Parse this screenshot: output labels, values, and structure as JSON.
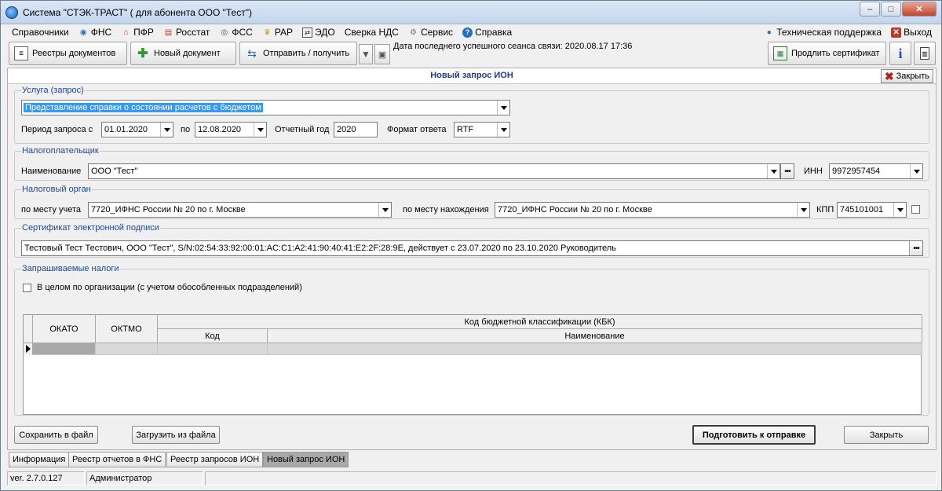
{
  "window": {
    "title": "Система \"СТЭК-ТРАСТ\" ( для абонента ООО \"Тест\")",
    "minimize": "‒",
    "maximize": "□",
    "close": "✕"
  },
  "menu": {
    "items": [
      {
        "label": "Справочники",
        "icon": ""
      },
      {
        "label": "ФНС",
        "icon": "fns-icon"
      },
      {
        "label": "ПФР",
        "icon": "pfr-icon"
      },
      {
        "label": "Росстат",
        "icon": "rosstat-icon"
      },
      {
        "label": "ФСС",
        "icon": "fss-icon"
      },
      {
        "label": "РАР",
        "icon": "rar-icon"
      },
      {
        "label": "ЭДО",
        "icon": "edo-icon"
      },
      {
        "label": "Сверка НДС",
        "icon": ""
      },
      {
        "label": "Сервис",
        "icon": "gear-icon"
      },
      {
        "label": "Справка",
        "icon": "help-icon"
      }
    ],
    "support": "Техническая поддержка",
    "exit": "Выход"
  },
  "toolbar": {
    "registries": "Реестры документов",
    "new_doc": "Новый документ",
    "send_receive": "Отправить / получить",
    "session_label": "Дата последнего успешного сеанса связи: 2020.08.17 17:36",
    "extend_cert": "Продлить сертификат"
  },
  "form": {
    "title": "Новый запрос ИОН",
    "close_top": "Закрыть",
    "service": {
      "legend": "Услуга (запрос)",
      "value": "Представление справки о состоянии расчетов с бюджетом",
      "period_label": "Период запроса  с",
      "date_from": "01.01.2020",
      "to_label": "по",
      "date_to": "12.08.2020",
      "year_label": "Отчетный год",
      "year": "2020",
      "format_label": "Формат ответа",
      "format": "RTF"
    },
    "taxpayer": {
      "legend": "Налогоплательщик",
      "name_label": "Наименование",
      "name": "ООО \"Тест\"",
      "inn_label": "ИНН",
      "inn": "9972957454"
    },
    "tax_authority": {
      "legend": "Налоговый орган",
      "reg_label": "по месту учета",
      "reg_value": "7720_ИФНС России № 20 по г. Москве",
      "loc_label": "по месту нахождения",
      "loc_value": "7720_ИФНС России № 20 по г. Москве",
      "kpp_label": "КПП",
      "kpp": "745101001"
    },
    "certificate": {
      "legend": "Сертификат электронной подписи",
      "value": "Тестовый Тест Тестович, ООО \"Тест\", S/N:02:54:33:92:00:01:AC:C1:A2:41:90:40:41:E2:2F:28:9E, действует с 23.07.2020 по 23.10.2020 Руководитель"
    },
    "taxes": {
      "legend": "Запрашиваемые налоги",
      "whole_org": "В целом по организации (с учетом обособленных подразделений)",
      "columns": {
        "okato": "ОКАТО",
        "oktmo": "ОКТМО",
        "kbk": "Код бюджетной классификации (КБК)",
        "code": "Код",
        "name": "Наименование"
      }
    },
    "buttons": {
      "save_file": "Сохранить в файл",
      "load_file": "Загрузить из файла",
      "prepare": "Подготовить к отправке",
      "close": "Закрыть"
    }
  },
  "tabs": [
    "Информация",
    "Реестр отчетов в ФНС",
    "Реестр запросов ИОН",
    "Новый запрос ИОН"
  ],
  "status": {
    "version": "ver. 2.7.0.127",
    "user": "Администратор"
  }
}
